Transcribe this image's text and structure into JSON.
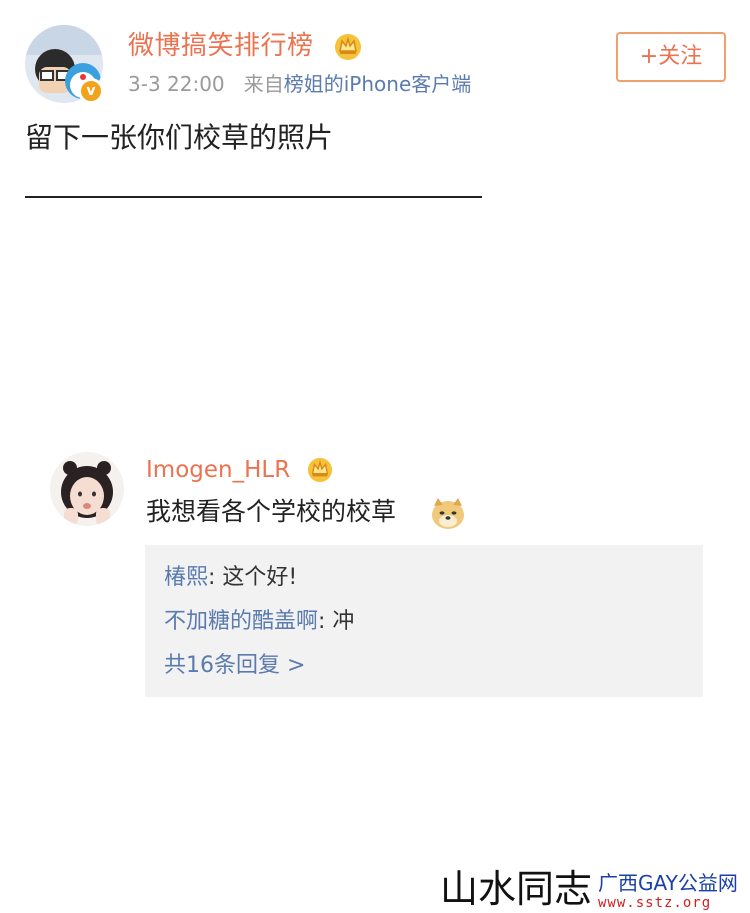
{
  "post": {
    "author": "微博搞笑排行榜",
    "time": "3-3 22:00",
    "from_prefix": "来自",
    "source": "榜姐的iPhone客户端",
    "follow_label": "+关注",
    "text": "留下一张你们校草的照片"
  },
  "comment": {
    "username": "Imogen_HLR",
    "text": "我想看各个学校的校草",
    "replies": [
      {
        "user": "椿熙",
        "sep": ": ",
        "text": "这个好!"
      },
      {
        "user": "不加糖的酷盖啊",
        "sep": ": ",
        "text": "冲"
      }
    ],
    "more_label": "共16条回复 >"
  },
  "watermark": {
    "main": "山水同志",
    "top": "广西GAY公益网",
    "bottom": "www.sstz.org"
  },
  "colors": {
    "accent": "#eb7350",
    "link": "#5b7bb0",
    "crown": "#f2a31b"
  }
}
